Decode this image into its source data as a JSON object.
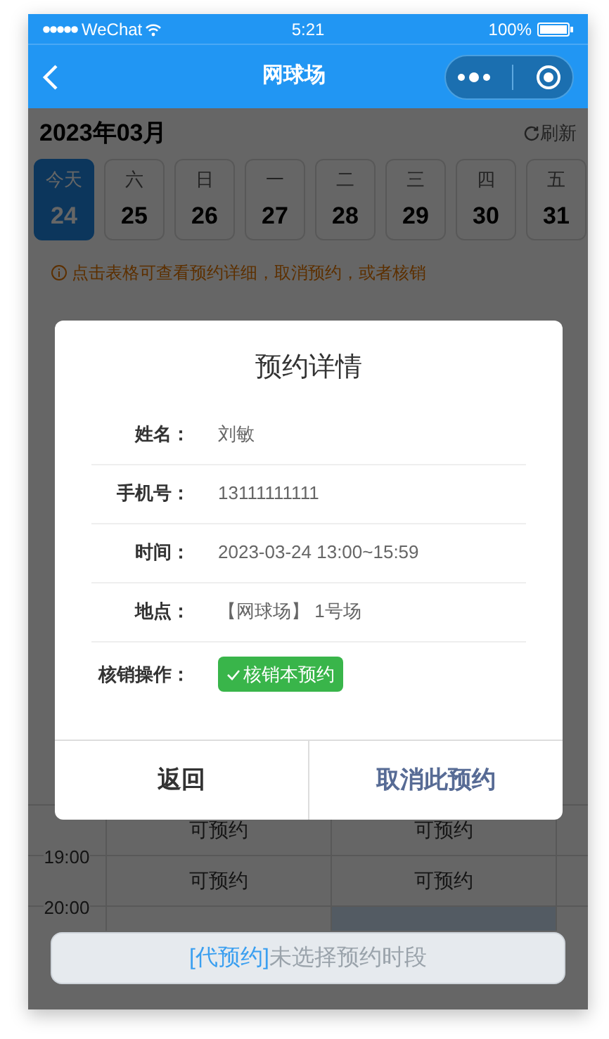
{
  "status_bar": {
    "carrier": "WeChat",
    "time": "5:21",
    "battery": "100%"
  },
  "nav": {
    "title": "网球场"
  },
  "header": {
    "month": "2023年03月",
    "refresh": "刷新"
  },
  "days": [
    {
      "weekday": "今天",
      "date": "24",
      "selected": true
    },
    {
      "weekday": "六",
      "date": "25",
      "selected": false
    },
    {
      "weekday": "日",
      "date": "26",
      "selected": false
    },
    {
      "weekday": "一",
      "date": "27",
      "selected": false
    },
    {
      "weekday": "二",
      "date": "28",
      "selected": false
    },
    {
      "weekday": "三",
      "date": "29",
      "selected": false
    },
    {
      "weekday": "四",
      "date": "30",
      "selected": false
    },
    {
      "weekday": "五",
      "date": "31",
      "selected": false
    }
  ],
  "tip": "点击表格可查看预约详细，取消预约，或者核销",
  "table": {
    "rows": [
      {
        "cells": [
          {
            "kind": "open",
            "text": "可预约"
          },
          {
            "kind": "open",
            "text": "可预约"
          }
        ]
      },
      {
        "time": "19:00",
        "cells": [
          {
            "kind": "open",
            "text": "可预约"
          },
          {
            "kind": "open",
            "text": "可预约"
          }
        ]
      },
      {
        "time": "20:00",
        "cells": [
          {
            "kind": "open"
          },
          {
            "kind": "booked"
          }
        ]
      }
    ]
  },
  "dialog": {
    "title": "预约详情",
    "fields": [
      {
        "label": "姓名：",
        "value": "刘敏"
      },
      {
        "label": "手机号：",
        "value": "13111111111"
      },
      {
        "label": "时间：",
        "value": "2023-03-24 13:00~15:59"
      },
      {
        "label": "地点：",
        "value": "【网球场】 1号场"
      }
    ],
    "action_label": "核销操作：",
    "action_button": "核销本预约",
    "buttons": [
      {
        "label": "返回",
        "kind": "back"
      },
      {
        "label": "取消此预约",
        "kind": "cancel"
      }
    ]
  },
  "bottom_bar": {
    "tag": "[代预约]",
    "text": "未选择预约时段"
  }
}
